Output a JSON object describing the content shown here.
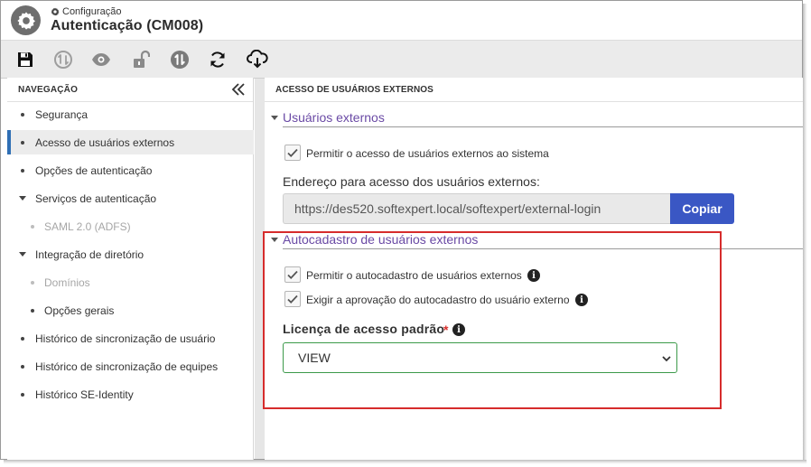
{
  "header": {
    "breadcrumb": "Configuração",
    "title": "Autenticação (CM008)"
  },
  "toolbar": {
    "buttons": [
      {
        "name": "save-icon",
        "label": "Salvar"
      },
      {
        "name": "sync-disabled-icon",
        "label": ""
      },
      {
        "name": "eye-icon",
        "label": ""
      },
      {
        "name": "unlock-icon",
        "label": ""
      },
      {
        "name": "sync-icon",
        "label": ""
      },
      {
        "name": "refresh-icon",
        "label": ""
      },
      {
        "name": "cloud-download-icon",
        "label": ""
      }
    ]
  },
  "sidebar": {
    "title": "NAVEGAÇÃO",
    "items": [
      {
        "label": "Segurança"
      },
      {
        "label": "Acesso de usuários externos"
      },
      {
        "label": "Opções de autenticação"
      },
      {
        "label": "Serviços de autenticação"
      },
      {
        "label": "SAML 2.0 (ADFS)"
      },
      {
        "label": "Integração de diretório"
      },
      {
        "label": "Domínios"
      },
      {
        "label": "Opções gerais"
      },
      {
        "label": "Histórico de sincronização de usuário"
      },
      {
        "label": "Histórico de sincronização de equipes"
      },
      {
        "label": "Histórico SE-Identity"
      }
    ]
  },
  "main": {
    "title": "ACESSO DE USUÁRIOS EXTERNOS",
    "section1": {
      "title": "Usuários externos",
      "allow_label": "Permitir o acesso de usuários externos ao sistema",
      "allow_checked": true,
      "url_label": "Endereço para acesso dos usuários externos:",
      "url_value": "https://des520.softexpert.local/softexpert/external-login",
      "copy_label": "Copiar"
    },
    "section2": {
      "title": "Autocadastro de usuários externos",
      "self_register_label": "Permitir o autocadastro de usuários externos",
      "self_register_checked": true,
      "approval_label": "Exigir a aprovação do autocadastro do usuário externo",
      "approval_checked": true,
      "license_label": "Licença de acesso padrão",
      "license_required": "*",
      "license_value": "VIEW"
    }
  },
  "colors": {
    "accent_link": "#6a4aa5",
    "copy_button": "#3a57c4",
    "select_border": "#3c9a4a",
    "highlight": "#d62c2c",
    "active_marker": "#2f6fb5"
  }
}
